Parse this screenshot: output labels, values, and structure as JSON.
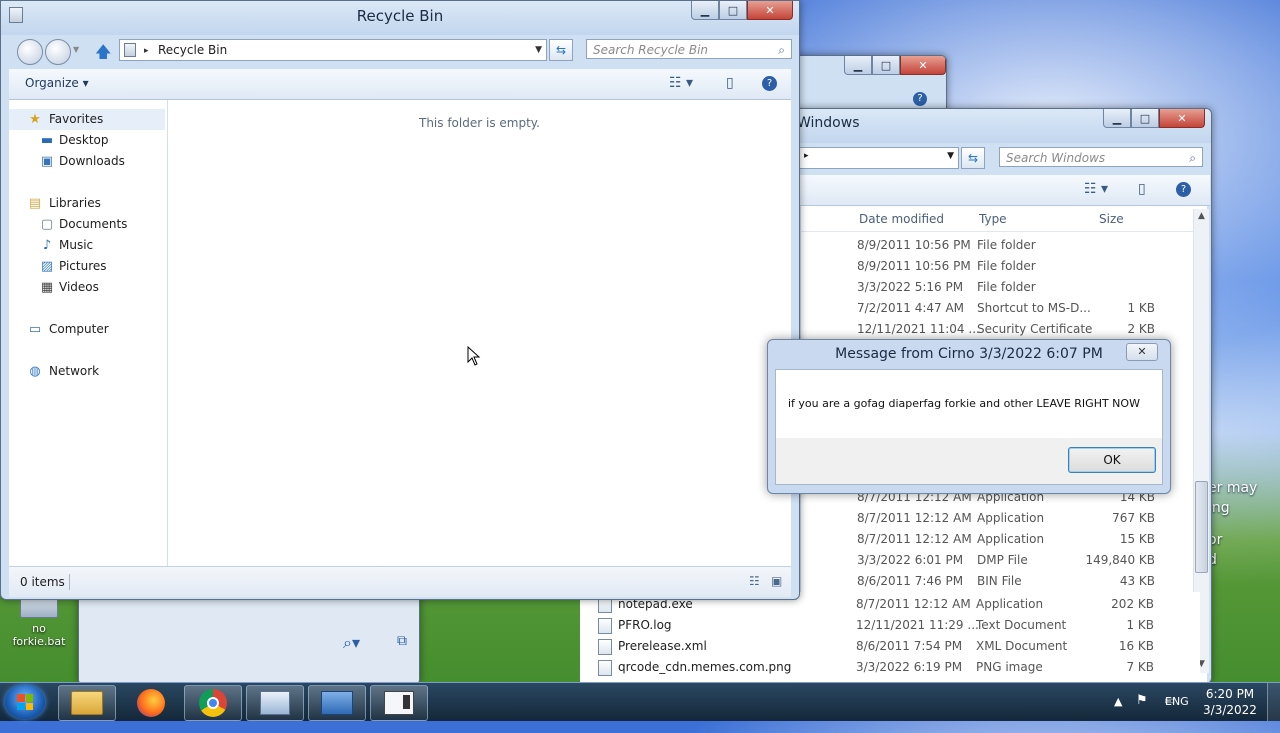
{
  "desktop": {
    "icon_label": "no forkie.bat"
  },
  "recycle_bin": {
    "title": "Recycle Bin",
    "address": "Recycle Bin",
    "search_placeholder": "Search Recycle Bin",
    "organize": "Organize ▾",
    "empty_message": "This folder is empty.",
    "status": "0 items",
    "nav": {
      "favorites": "Favorites",
      "desktop": "Desktop",
      "downloads": "Downloads",
      "libraries": "Libraries",
      "documents": "Documents",
      "music": "Music",
      "pictures": "Pictures",
      "videos": "Videos",
      "computer": "Computer",
      "network": "Network"
    }
  },
  "windows_explorer": {
    "title": "Windows",
    "search_placeholder": "Search Windows",
    "columns": {
      "date": "Date modified",
      "type": "Type",
      "size": "Size"
    },
    "rows_top": [
      {
        "date": "8/9/2011 10:56 PM",
        "type": "File folder",
        "size": ""
      },
      {
        "date": "8/9/2011 10:56 PM",
        "type": "File folder",
        "size": ""
      },
      {
        "date": "3/3/2022 5:16 PM",
        "type": "File folder",
        "size": ""
      },
      {
        "date": "7/2/2011 4:47 AM",
        "type": "Shortcut to MS-D...",
        "size": "1 KB"
      },
      {
        "date": "12/11/2021 11:04 ...",
        "type": "Security Certificate",
        "size": "2 KB"
      }
    ],
    "rows_bottom": [
      {
        "date": "8/7/2011 12:12 AM",
        "type": "Application",
        "size": "14 KB"
      },
      {
        "date": "8/7/2011 12:12 AM",
        "type": "Application",
        "size": "767 KB"
      },
      {
        "date": "8/7/2011 12:12 AM",
        "type": "Application",
        "size": "15 KB"
      },
      {
        "date": "3/3/2022 6:01 PM",
        "type": "DMP File",
        "size": "149,840 KB"
      },
      {
        "date": "8/6/2011 7:46 PM",
        "type": "BIN File",
        "size": "43 KB"
      }
    ],
    "rows_named": [
      {
        "name": "notepad.exe",
        "date": "8/7/2011 12:12 AM",
        "type": "Application",
        "size": "202 KB"
      },
      {
        "name": "PFRO.log",
        "date": "12/11/2021 11:29 ...",
        "type": "Text Document",
        "size": "1 KB"
      },
      {
        "name": "Prerelease.xml",
        "date": "8/6/2011 7:54 PM",
        "type": "XML Document",
        "size": "16 KB"
      },
      {
        "name": "qrcode_cdn.memes.com.png",
        "date": "3/3/2022 6:19 PM",
        "type": "PNG image",
        "size": "7 KB"
      }
    ]
  },
  "message_box": {
    "title": "Message from Cirno 3/3/2022 6:07 PM",
    "text": "if you are a gofag diaperfag forkie and other LEAVE RIGHT NOW",
    "ok": "OK"
  },
  "taskbar": {
    "language": "ENG",
    "time": "6:20 PM",
    "date": "3/3/2022"
  },
  "wallpaper_text": [
    "er may",
    "ing",
    "or",
    "d"
  ]
}
